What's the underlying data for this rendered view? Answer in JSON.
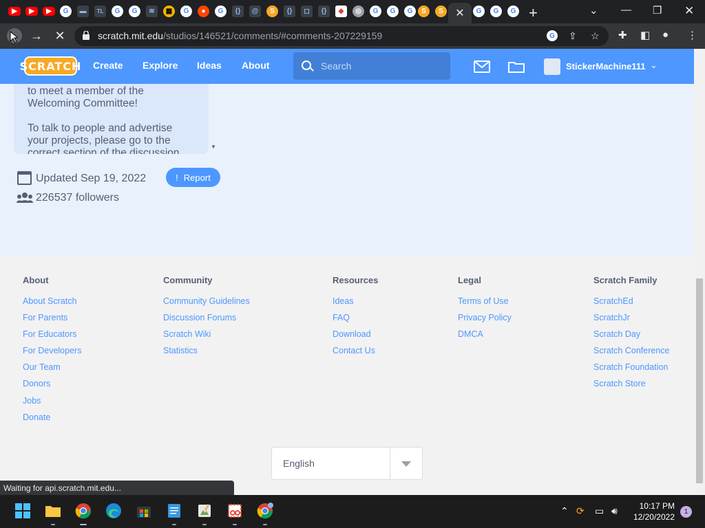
{
  "browser": {
    "url_host": "scratch.mit.edu",
    "url_path": "/studios/146521/comments/#comments-207229159",
    "status_text": "Waiting for api.scratch.mit.edu..."
  },
  "navbar": {
    "logo_text": "SCRATCH",
    "links": [
      "Create",
      "Explore",
      "Ideas",
      "About"
    ],
    "search_placeholder": "Search",
    "username": "StickerMachine111"
  },
  "studio": {
    "description_lines": [
      "to meet a member of the Welcoming Committee!",
      "To talk to people and advertise your projects, please go to the correct section of the discussion"
    ],
    "updated": "Updated Sep 19, 2022",
    "followers": "226537 followers",
    "report_label": "Report"
  },
  "footer": {
    "columns": [
      {
        "heading": "About",
        "links": [
          "About Scratch",
          "For Parents",
          "For Educators",
          "For Developers",
          "Our Team",
          "Donors",
          "Jobs",
          "Donate"
        ]
      },
      {
        "heading": "Community",
        "links": [
          "Community Guidelines",
          "Discussion Forums",
          "Scratch Wiki",
          "Statistics"
        ]
      },
      {
        "heading": "Resources",
        "links": [
          "Ideas",
          "FAQ",
          "Download",
          "Contact Us"
        ]
      },
      {
        "heading": "Legal",
        "links": [
          "Terms of Use",
          "Privacy Policy",
          "DMCA"
        ]
      },
      {
        "heading": "Scratch Family",
        "links": [
          "ScratchEd",
          "ScratchJr",
          "Scratch Day",
          "Scratch Conference",
          "Scratch Foundation",
          "Scratch Store"
        ]
      }
    ],
    "language": "English"
  },
  "taskbar": {
    "time": "10:17 PM",
    "date": "12/20/2022",
    "notification_count": "1"
  },
  "colors": {
    "scratch_blue": "#4d97ff",
    "scratch_orange": "#f9a825",
    "text_gray": "#575e75"
  }
}
